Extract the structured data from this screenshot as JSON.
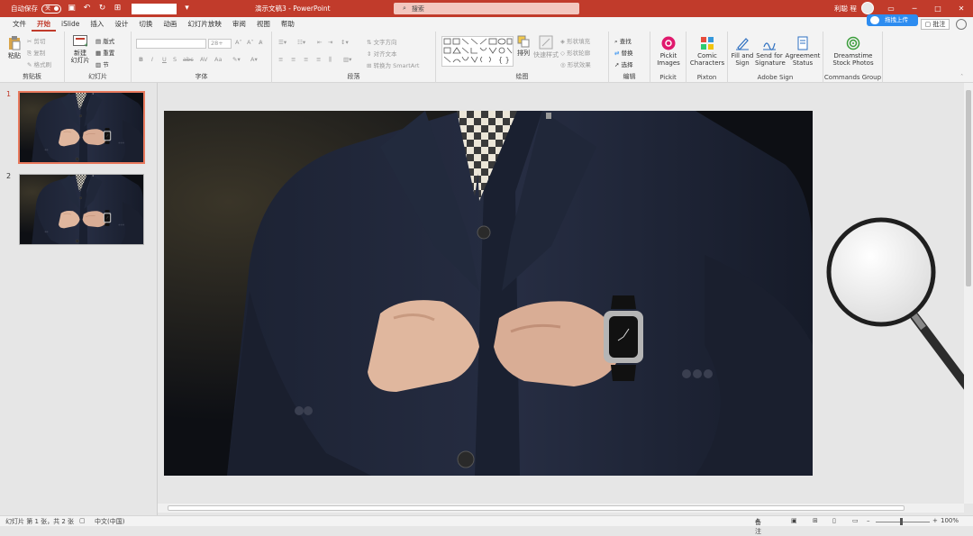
{
  "titlebar": {
    "autosave_label": "自动保存",
    "autosave_state": "关",
    "document_title": "演示文稿3",
    "app_separator": "-",
    "app_name": "PowerPoint",
    "search_placeholder": "搜索",
    "user_name": "利聪 程",
    "upload_label": "拖拽上传"
  },
  "menu": {
    "items": [
      "文件",
      "开始",
      "iSlide",
      "插入",
      "设计",
      "切换",
      "动画",
      "幻灯片放映",
      "审阅",
      "视图",
      "帮助"
    ],
    "active": "开始",
    "comment_label": "批注"
  },
  "ribbon": {
    "clipboard": {
      "paste": "粘贴",
      "cut": "剪切",
      "copy": "复制",
      "format_painter": "格式刷",
      "label": "剪贴板"
    },
    "slides": {
      "new_slide_1": "新建",
      "new_slide_2": "幻灯片",
      "layout": "版式",
      "reset": "重置",
      "section": "节",
      "label": "幻灯片"
    },
    "font": {
      "size": "28+",
      "bold": "B",
      "italic": "I",
      "underline": "U",
      "strike": "S",
      "spacing": "abc",
      "aa": "Aa",
      "label": "字体"
    },
    "paragraph": {
      "text_direction": "文字方向",
      "align_text": "对齐文本",
      "smartart": "转换为 SmartArt",
      "label": "段落"
    },
    "drawing": {
      "arrange": "排列",
      "quick_styles": "快速样式",
      "fill": "形状填充",
      "outline": "形状轮廓",
      "effects": "形状效果",
      "label": "绘图"
    },
    "editing": {
      "find": "查找",
      "replace": "替换",
      "select": "选择",
      "label": "编辑"
    },
    "pickit": {
      "button_1": "Pickit",
      "button_2": "Images",
      "label": "Pickit"
    },
    "pixton": {
      "button_1": "Comic",
      "button_2": "Characters",
      "label": "Pixton"
    },
    "adobe": {
      "fill_1": "Fill and",
      "fill_2": "Sign",
      "send_1": "Send for",
      "send_2": "Signature",
      "agree_1": "Agreement",
      "agree_2": "Status",
      "label": "Adobe Sign"
    },
    "commands": {
      "button_1": "Dreamstime",
      "button_2": "Stock Photos",
      "label": "Commands Group"
    }
  },
  "slides": {
    "items": [
      {
        "number": "1"
      },
      {
        "number": "2"
      }
    ],
    "selected": 1
  },
  "status": {
    "slide_info": "幻灯片 第 1 张，共 2 张",
    "language": "中文(中国)",
    "notes": "备注",
    "zoom": "100%"
  },
  "colors": {
    "accent": "#c13b2b",
    "selection": "#e8795d",
    "suit": "#1c2233"
  }
}
